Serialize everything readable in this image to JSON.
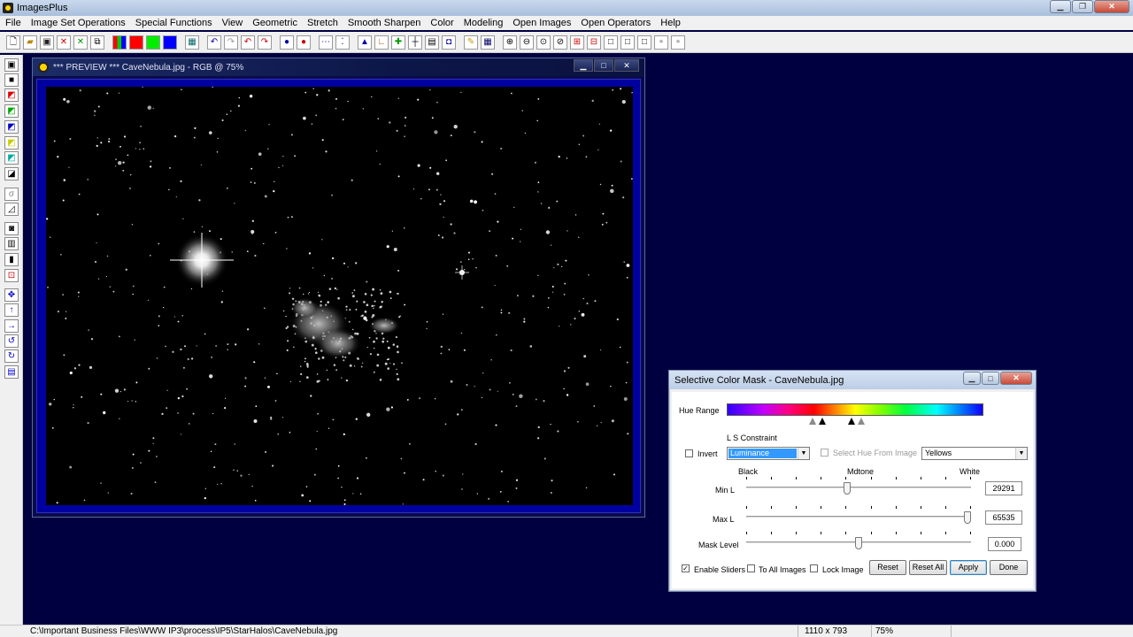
{
  "app": {
    "title": "ImagesPlus"
  },
  "menu": [
    "File",
    "Image Set Operations",
    "Special Functions",
    "View",
    "Geometric",
    "Stretch",
    "Smooth Sharpen",
    "Color",
    "Modeling",
    "Open Images",
    "Open Operators",
    "Help"
  ],
  "preview": {
    "title": "*** PREVIEW *** CaveNebula.jpg - RGB @ 75%"
  },
  "dialog": {
    "title": "Selective Color Mask - CaveNebula.jpg",
    "hue_range_label": "Hue Range",
    "ls_constraint_label": "L S Constraint",
    "invert_label": "Invert",
    "invert_checked": false,
    "constraint_value": "Luminance",
    "select_hue_label": "Select Hue From Image",
    "color_value": "Yellows",
    "scale_labels": {
      "black": "Black",
      "mdtone": "Mdtone",
      "white": "White"
    },
    "min_l": {
      "label": "Min L",
      "value": "29291",
      "fraction": 0.447
    },
    "max_l": {
      "label": "Max L",
      "value": "65535",
      "fraction": 1.0
    },
    "mask_level": {
      "label": "Mask Level",
      "value": "0.000",
      "fraction": 0.5
    },
    "enable_sliders_label": "Enable Sliders",
    "enable_sliders_checked": true,
    "to_all_images_label": "To All Images",
    "lock_image_label": "Lock Image",
    "buttons": {
      "reset": "Reset",
      "reset_all": "Reset All",
      "apply": "Apply",
      "done": "Done"
    }
  },
  "status": {
    "path": "C:\\Important Business Files\\WWW IP3\\process\\IP5\\StarHalos\\CaveNebula.jpg",
    "dimensions": "1110 x 793",
    "zoom": "75%"
  },
  "colors": {
    "workspace": "#000040",
    "hue_bar_start": "#3000ff",
    "preview_frame": "#0000a0"
  },
  "icons": {
    "toolbar": [
      "new-icon",
      "open-icon",
      "save-icon",
      "close-icon",
      "close-all-icon",
      "copy-icon",
      "rgb-icon",
      "red-channel-icon",
      "green-channel-icon",
      "blue-channel-icon",
      "grid-icon",
      "undo-icon",
      "redo-icon",
      "undo-all-icon",
      "redo-all-icon",
      "record-icon",
      "stop-icon",
      "dots-icon",
      "coords-icon",
      "histogram-icon",
      "axis-icon",
      "add-icon",
      "crosshair-icon",
      "table-icon",
      "camera-icon",
      "pencil-icon",
      "grid2-icon",
      "zoom-in-icon",
      "zoom-out-icon",
      "zoom-fit-icon",
      "zoom-reset-icon",
      "add-frame-icon",
      "remove-frame-icon",
      "frame1-icon",
      "frame2-icon",
      "frame3-icon",
      "frame4-icon",
      "frame5-icon"
    ],
    "left": [
      "save-icon",
      "black-icon",
      "red-black-icon",
      "green-black-icon",
      "blue-black-icon",
      "yellow-black-icon",
      "cyan-black-icon",
      "white-black-icon",
      "gamma-icon",
      "curve-icon",
      "levels-icon",
      "bars-icon",
      "column-icon",
      "crop-icon",
      "move-icon",
      "up-arrow-icon",
      "right-arrow-icon",
      "rotate-left-icon",
      "rotate-right-icon",
      "info-icon"
    ]
  }
}
